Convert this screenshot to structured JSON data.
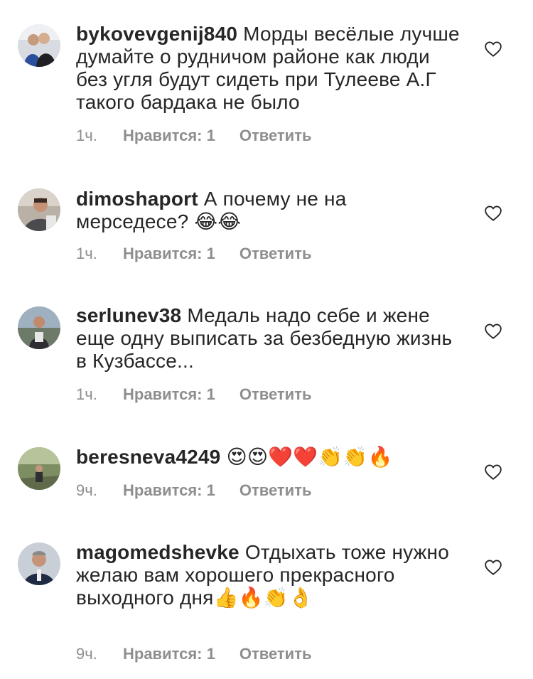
{
  "comments": [
    {
      "username": "bykovevgenij840",
      "text": "Морды весёлые лучше думайте о рудничом районе как люди без угля будут сидеть при Тулееве А.Г такого бардака не было",
      "time": "1ч.",
      "likes": "Нравится: 1",
      "reply": "Ответить"
    },
    {
      "username": "dimoshaport",
      "text": "А почему не на мерседесе? 😂😂",
      "time": "1ч.",
      "likes": "Нравится: 1",
      "reply": "Ответить"
    },
    {
      "username": "serlunev38",
      "text": "Медаль надо себе и жене еще одну выписать за безбедную жизнь в Кузбассе...",
      "time": "1ч.",
      "likes": "Нравится: 1",
      "reply": "Ответить"
    },
    {
      "username": "beresneva4249",
      "text": "😍😍❤️❤️👏👏🔥",
      "time": "9ч.",
      "likes": "Нравится: 1",
      "reply": "Ответить"
    },
    {
      "username": "magomedshevke",
      "text": "Отдыхать тоже нужно желаю вам хорошего прекрасного выходного дня👍🔥👏👌",
      "time": "9ч.",
      "likes": "Нравится: 1",
      "reply": "Ответить"
    }
  ]
}
